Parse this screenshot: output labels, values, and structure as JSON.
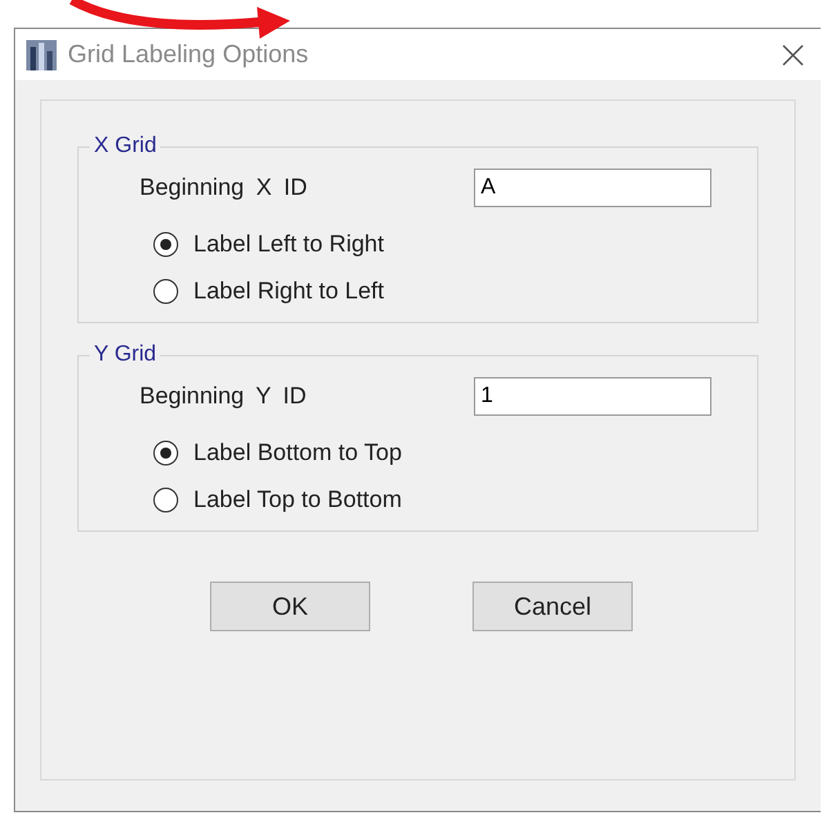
{
  "window": {
    "title": "Grid Labeling Options"
  },
  "groups": [
    {
      "title": "X Grid",
      "field_label": "Beginning X ID",
      "value": "A",
      "options": [
        {
          "label": "Label Left to Right",
          "selected": true
        },
        {
          "label": "Label Right to Left",
          "selected": false
        }
      ]
    },
    {
      "title": "Y Grid",
      "field_label": "Beginning Y ID",
      "value": "1",
      "options": [
        {
          "label": "Label Bottom to Top",
          "selected": true
        },
        {
          "label": "Label Top to Bottom",
          "selected": false
        }
      ]
    }
  ],
  "buttons": [
    "OK",
    "Cancel"
  ]
}
